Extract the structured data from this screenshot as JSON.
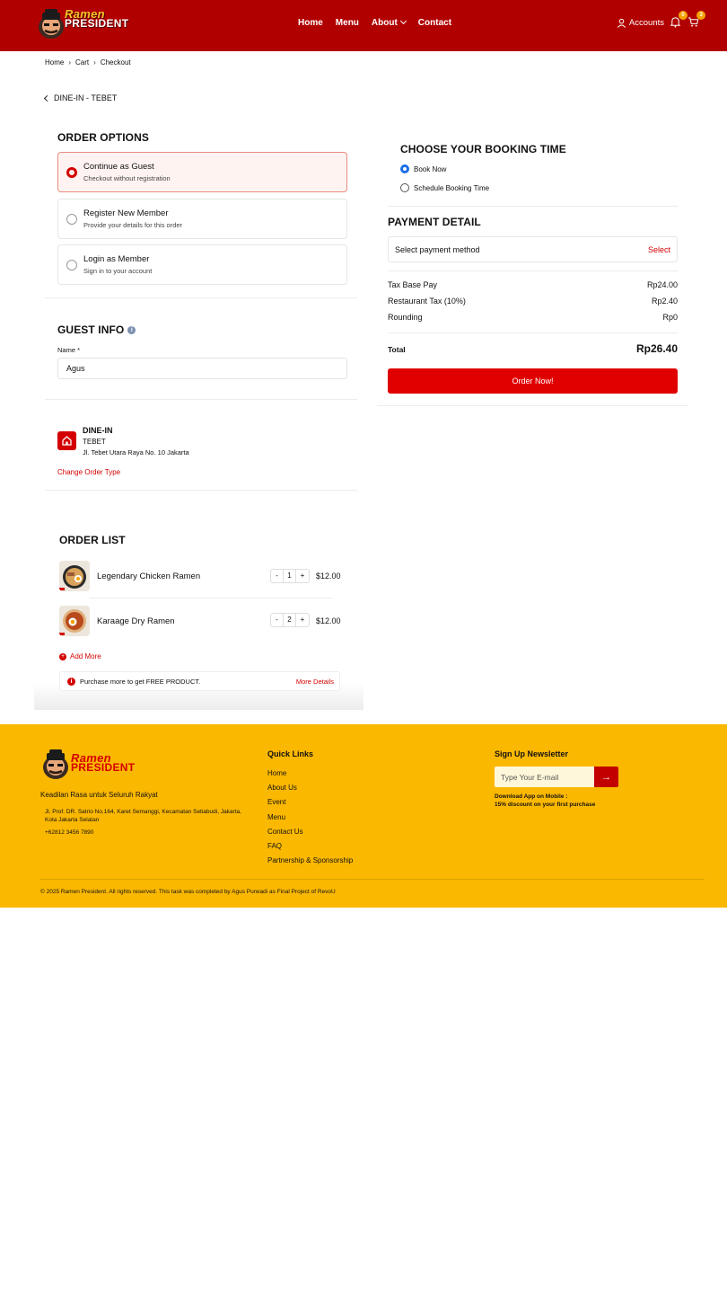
{
  "header": {
    "brand_line1": "Ramen",
    "brand_line2": "PRESIDENT",
    "nav": [
      "Home",
      "Menu",
      "About",
      "Contact"
    ],
    "accounts_label": "Accounts",
    "notif_count": "0",
    "cart_count": "3",
    "colors": {
      "bg": "#b10000",
      "brand_yellow": "#ffd23a"
    }
  },
  "breadcrumb": [
    "Home",
    "Cart",
    "Checkout"
  ],
  "back_label": "DINE-IN - TEBET",
  "order_options": {
    "title": "ORDER OPTIONS",
    "options": [
      {
        "title": "Continue as Guest",
        "subtitle": "Checkout without registration",
        "selected": true
      },
      {
        "title": "Register New Member",
        "subtitle": "Provide your details for this order",
        "selected": false
      },
      {
        "title": "Login as Member",
        "subtitle": "Sign in to your account",
        "selected": false
      }
    ]
  },
  "guest_info": {
    "title": "GUEST INFO",
    "name_label": "Name *",
    "name_value": "Agus"
  },
  "dine_in": {
    "type": "DINE-IN",
    "branch": "TEBET",
    "address": "Jl. Tebet Utara Raya No. 10 Jakarta",
    "change_label": "Change Order Type",
    "icon": "home-icon"
  },
  "order_list": {
    "title": "ORDER LIST",
    "items": [
      {
        "name": "Legendary Chicken Ramen",
        "qty": "1",
        "price": "$12.00"
      },
      {
        "name": "Karaage Dry Ramen",
        "qty": "2",
        "price": "$12.00"
      }
    ],
    "minus": "-",
    "plus": "+",
    "add_more": "Add More",
    "promo_text": "Purchase more to get FREE PRODUCT.",
    "promo_link": "More Details"
  },
  "booking": {
    "title": "CHOOSE YOUR BOOKING TIME",
    "options": [
      "Book Now",
      "Schedule Booking Time"
    ],
    "selected": "Book Now"
  },
  "payment": {
    "title": "PAYMENT DETAIL",
    "select_label": "Select payment method",
    "select_action": "Select",
    "rows": [
      {
        "label": "Tax Base Pay",
        "value": "Rp24.00"
      },
      {
        "label": "Restaurant Tax (10%)",
        "value": "Rp2.40"
      },
      {
        "label": "Rounding",
        "value": "Rp0"
      }
    ],
    "total_label": "Total",
    "total_value": "Rp26.40",
    "order_button": "Order Now!"
  },
  "footer": {
    "tagline": "Keadilan Rasa untuk Seluruh Rakyat",
    "address": "Jl. Prof. DR. Satrio No.164, Karet Semanggi, Kecamatan Setiabudi, Jakarta, Kota Jakarta Selatan",
    "phone": "+62812 3456 7890",
    "quick_links_title": "Quick Links",
    "quick_links": [
      "Home",
      "About Us",
      "Event",
      "Menu",
      "Contact Us",
      "FAQ",
      "Partnership & Sponsorship"
    ],
    "newsletter_title": "Sign Up Newsletter",
    "newsletter_placeholder": "Type Your E-mail",
    "newsletter_button": "→",
    "app_line1": "Download App on Mobile :",
    "app_line2": "15% discount on your first purchase",
    "copyright": "© 2025 Ramen President. All rights reserved. This task was completed by Agus Purwadi as Final Project of RevoU",
    "colors": {
      "bg": "#fbb800"
    }
  }
}
